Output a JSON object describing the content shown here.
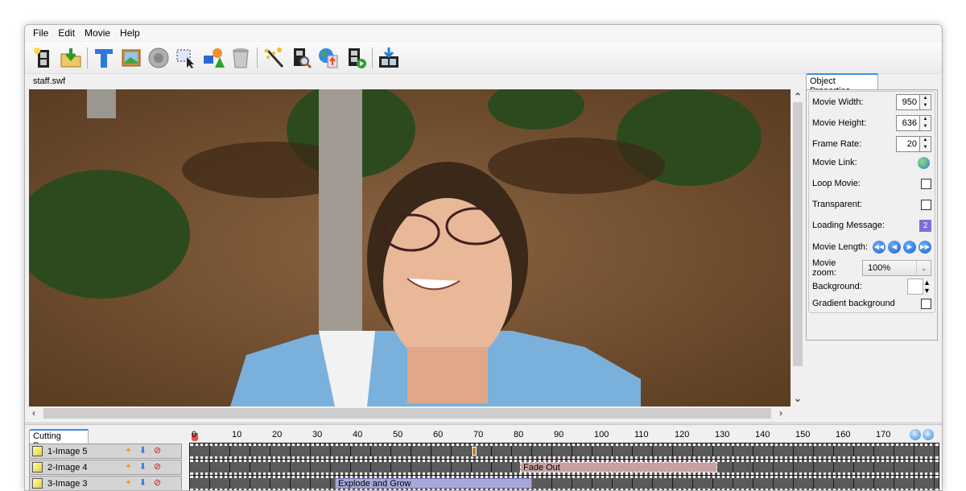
{
  "menu": [
    "File",
    "Edit",
    "Movie",
    "Help"
  ],
  "toolbar": {
    "buttons": [
      {
        "name": "new-movie-icon"
      },
      {
        "name": "open-icon"
      },
      {
        "sep": true
      },
      {
        "name": "text-icon"
      },
      {
        "name": "image-icon"
      },
      {
        "name": "sound-icon"
      },
      {
        "name": "select-icon"
      },
      {
        "name": "shapes-icon"
      },
      {
        "name": "trash-icon"
      },
      {
        "sep": true
      },
      {
        "name": "magic-wand-icon"
      },
      {
        "name": "preview-icon"
      },
      {
        "name": "publish-web-icon"
      },
      {
        "name": "play-movie-icon"
      },
      {
        "sep": true
      },
      {
        "name": "export-icon"
      }
    ]
  },
  "file_name": "staff.swf",
  "properties": {
    "tab_label": "Object Properties",
    "movie_width_label": "Movie Width:",
    "movie_width": "950",
    "movie_height_label": "Movie Height:",
    "movie_height": "636",
    "frame_rate_label": "Frame Rate:",
    "frame_rate": "20",
    "movie_link_label": "Movie Link:",
    "loop_movie_label": "Loop Movie:",
    "transparent_label": "Transparent:",
    "loading_message_label": "Loading Message:",
    "movie_length_label": "Movie Length:",
    "movie_zoom_label": "Movie zoom:",
    "movie_zoom": "100%",
    "background_label": "Background:",
    "background_color": "#ffffff",
    "gradient_label": "Gradient background"
  },
  "cutting_room": {
    "tab_label": "Cutting Room",
    "layers": [
      {
        "name": "1-Image 5"
      },
      {
        "name": "2-Image 4"
      },
      {
        "name": "3-Image 3"
      }
    ]
  },
  "timeline": {
    "ticks": [
      "0",
      "10",
      "20",
      "30",
      "40",
      "50",
      "60",
      "70",
      "80",
      "90",
      "100",
      "110",
      "120",
      "130",
      "140",
      "150",
      "160",
      "170"
    ],
    "effects": [
      {
        "track": 1,
        "label": "Fade Out",
        "start": 82,
        "end": 131
      },
      {
        "track": 2,
        "label": "Explode and Grow",
        "start": 36,
        "end": 85
      }
    ],
    "keyframe": {
      "track": 0,
      "frame": 70
    }
  },
  "colors": {
    "accent": "#3c8de6",
    "fade_effect": "#c9a0a0",
    "explode_effect": "#a8a8d8"
  }
}
